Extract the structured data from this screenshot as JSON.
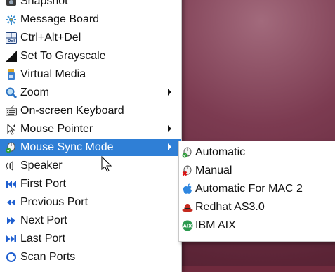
{
  "main_menu": {
    "items": [
      {
        "label": "Snapshot",
        "icon": "snapshot-icon"
      },
      {
        "label": "Message Board",
        "icon": "message-board-icon"
      },
      {
        "label": "Ctrl+Alt+Del",
        "icon": "ctrl-alt-del-icon"
      },
      {
        "label": "Set To Grayscale",
        "icon": "grayscale-icon"
      },
      {
        "label": "Virtual Media",
        "icon": "virtual-media-icon"
      },
      {
        "label": "Zoom",
        "icon": "zoom-icon",
        "has_submenu": true
      },
      {
        "label": "On-screen Keyboard",
        "icon": "keyboard-icon"
      },
      {
        "label": "Mouse Pointer",
        "icon": "mouse-pointer-icon",
        "has_submenu": true
      },
      {
        "label": "Mouse Sync Mode",
        "icon": "mouse-sync-icon",
        "has_submenu": true,
        "selected": true
      },
      {
        "label": "Speaker",
        "icon": "speaker-icon"
      },
      {
        "label": "First Port",
        "icon": "first-port-icon"
      },
      {
        "label": "Previous Port",
        "icon": "previous-port-icon"
      },
      {
        "label": "Next Port",
        "icon": "next-port-icon"
      },
      {
        "label": "Last Port",
        "icon": "last-port-icon"
      },
      {
        "label": "Scan Ports",
        "icon": "scan-ports-icon"
      }
    ]
  },
  "submenu": {
    "parent": "Mouse Sync Mode",
    "items": [
      {
        "label": "Automatic",
        "icon": "automatic-icon"
      },
      {
        "label": "Manual",
        "icon": "manual-icon"
      },
      {
        "label": "Automatic For MAC 2",
        "icon": "apple-icon"
      },
      {
        "label": "Redhat AS3.0",
        "icon": "redhat-icon"
      },
      {
        "label": "IBM AIX",
        "icon": "aix-icon"
      }
    ]
  },
  "colors": {
    "selection": "#2f7fd6",
    "desktop": "#6f2a3d",
    "port_arrows": "#1f5fd0"
  }
}
